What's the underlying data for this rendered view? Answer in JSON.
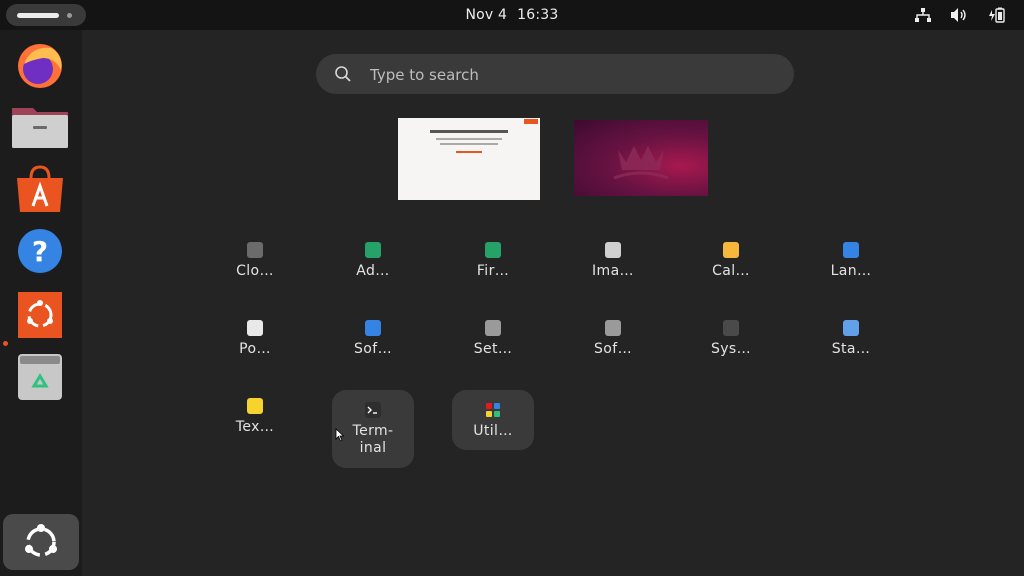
{
  "topbar": {
    "date": "Nov 4",
    "time": "16:33",
    "tray_icons": [
      "network-icon",
      "volume-icon",
      "battery-icon"
    ]
  },
  "dock": {
    "apps": [
      {
        "name": "firefox",
        "icon": "firefox-icon"
      },
      {
        "name": "files",
        "icon": "files-icon"
      },
      {
        "name": "app-center",
        "icon": "app-center-icon"
      },
      {
        "name": "help",
        "icon": "help-icon"
      },
      {
        "name": "ubuntu-installer",
        "icon": "ubuntu-installer-icon",
        "running": true
      },
      {
        "name": "trash",
        "icon": "trash-icon"
      }
    ],
    "show_apps_icon": "ubuntu-logo-icon"
  },
  "search": {
    "placeholder": "Type to search"
  },
  "workspaces": [
    {
      "name": "workspace-1",
      "content": "light"
    },
    {
      "name": "workspace-2",
      "content": "wallpaper"
    }
  ],
  "apps": [
    {
      "label": "Clo…",
      "icon": "clock-icon",
      "color": "#6b6b6b"
    },
    {
      "label": "Ad…",
      "icon": "chip-icon",
      "color": "#26a269"
    },
    {
      "label": "Fir…",
      "icon": "chip-icon",
      "color": "#26a269"
    },
    {
      "label": "Ima…",
      "icon": "image-viewer-icon",
      "color": "#d0d0d0"
    },
    {
      "label": "Cal…",
      "icon": "calculator-icon",
      "color": "#f6b73c"
    },
    {
      "label": "Lan…",
      "icon": "language-icon",
      "color": "#3584e4"
    },
    {
      "label": "Po…",
      "icon": "power-stats-icon",
      "color": "#e8e8e8"
    },
    {
      "label": "Sof…",
      "icon": "software-icon",
      "color": "#3584e4"
    },
    {
      "label": "Set…",
      "icon": "settings-icon",
      "color": "#9a9a9a"
    },
    {
      "label": "Sof…",
      "icon": "software-updater-icon",
      "color": "#9a9a9a"
    },
    {
      "label": "Sys…",
      "icon": "system-monitor-icon",
      "color": "#4a4a4a"
    },
    {
      "label": "Sta…",
      "icon": "startup-disk-icon",
      "color": "#62a0ea"
    },
    {
      "label": "Tex…",
      "icon": "text-editor-icon",
      "color": "#f6d32d"
    },
    {
      "label": "Term-\ninal",
      "icon": "terminal-icon",
      "color": "#2e2e2e",
      "hover": true
    },
    {
      "label": "Util…",
      "icon": "utilities-folder-icon",
      "color": "#3a3a3a",
      "folder": true
    }
  ],
  "accent": "#e95420"
}
